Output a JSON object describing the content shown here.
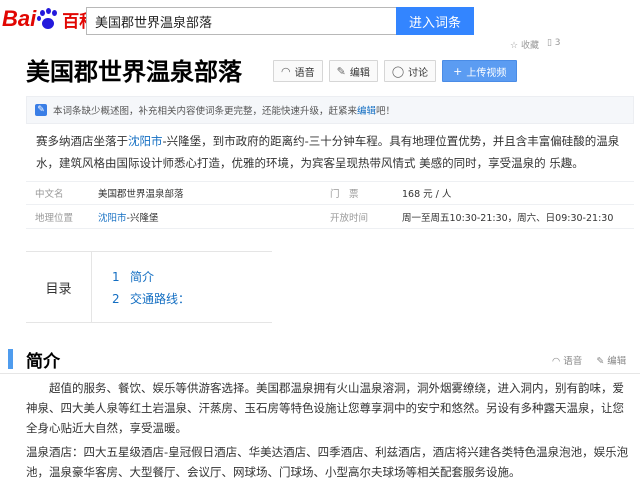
{
  "brand": {
    "logo_bai": "Bai",
    "logo_du": "du",
    "logo_baike": "百科"
  },
  "search": {
    "value": "美国郡世界温泉部落",
    "button_label": "进入词条"
  },
  "mini_tools": [
    "收藏",
    "3"
  ],
  "title": "美国郡世界温泉部落",
  "title_buttons": {
    "voice": "语音",
    "edit": "编辑",
    "discuss": "讨论",
    "upload": "上传视频"
  },
  "notice": {
    "text_before": "本词条缺少概述图，补充相关内容使词条更完整，还能快速升级，赶紧来",
    "link": "编辑",
    "text_after": "吧！"
  },
  "intro": {
    "pre": "赛多纳酒店坐落于",
    "link": "沈阳市",
    "post": "-兴隆堡，到市政府的距离约-三十分钟车程。具有地理位置优势，并且含丰富偏硅酸的温泉水，建筑风格由国际设计师悉心打造，优雅的环境，为宾客呈现热带风情式 美感的同时，享受温泉的 乐趣。"
  },
  "basic_info": {
    "row1": {
      "k1": "中文名",
      "v1": "美国郡世界温泉部落",
      "k2": "门　票",
      "v2": "168 元 / 人"
    },
    "row2": {
      "k1": "地理位置",
      "v1_link": "沈阳市",
      "v1_rest": "-兴隆堡",
      "k2": "开放时间",
      "v2": "周一至周五10:30-21:30，周六、日09:30-21:30"
    }
  },
  "catalog": {
    "label": "目录",
    "items": [
      {
        "num": "1",
        "label": "简介"
      },
      {
        "num": "2",
        "label": "交通路线："
      }
    ]
  },
  "section": {
    "title": "简介",
    "voice": "语音",
    "edit": "编辑"
  },
  "paragraphs": {
    "p1": "超值的服务、餐饮、娱乐等供游客选择。美国郡温泉拥有火山温泉溶洞，洞外烟雾缭绕，进入洞内，别有韵味，爱神泉、四大美人泉等红土岩温泉、汗蒸房、玉石房等特色设施让您尊享洞中的安宁和悠然。另设有多种露天温泉，让您全身心贴近大自然，享受温暖。",
    "p2": "温泉酒店：四大五星级酒店-皇冠假日酒店、华美达酒店、四季酒店、利兹酒店，酒店将兴建各类特色温泉泡池，娱乐泡池，温泉豪华客房、大型餐厅、会议厅、网球场、门球场、小型高尔夫球场等相关配套服务设施。"
  },
  "colors": {
    "link": "#136ec2",
    "accent": "#3385ff",
    "section_bar": "#4f9cee",
    "logo_red": "#e10602",
    "logo_blue": "#2319dc"
  }
}
